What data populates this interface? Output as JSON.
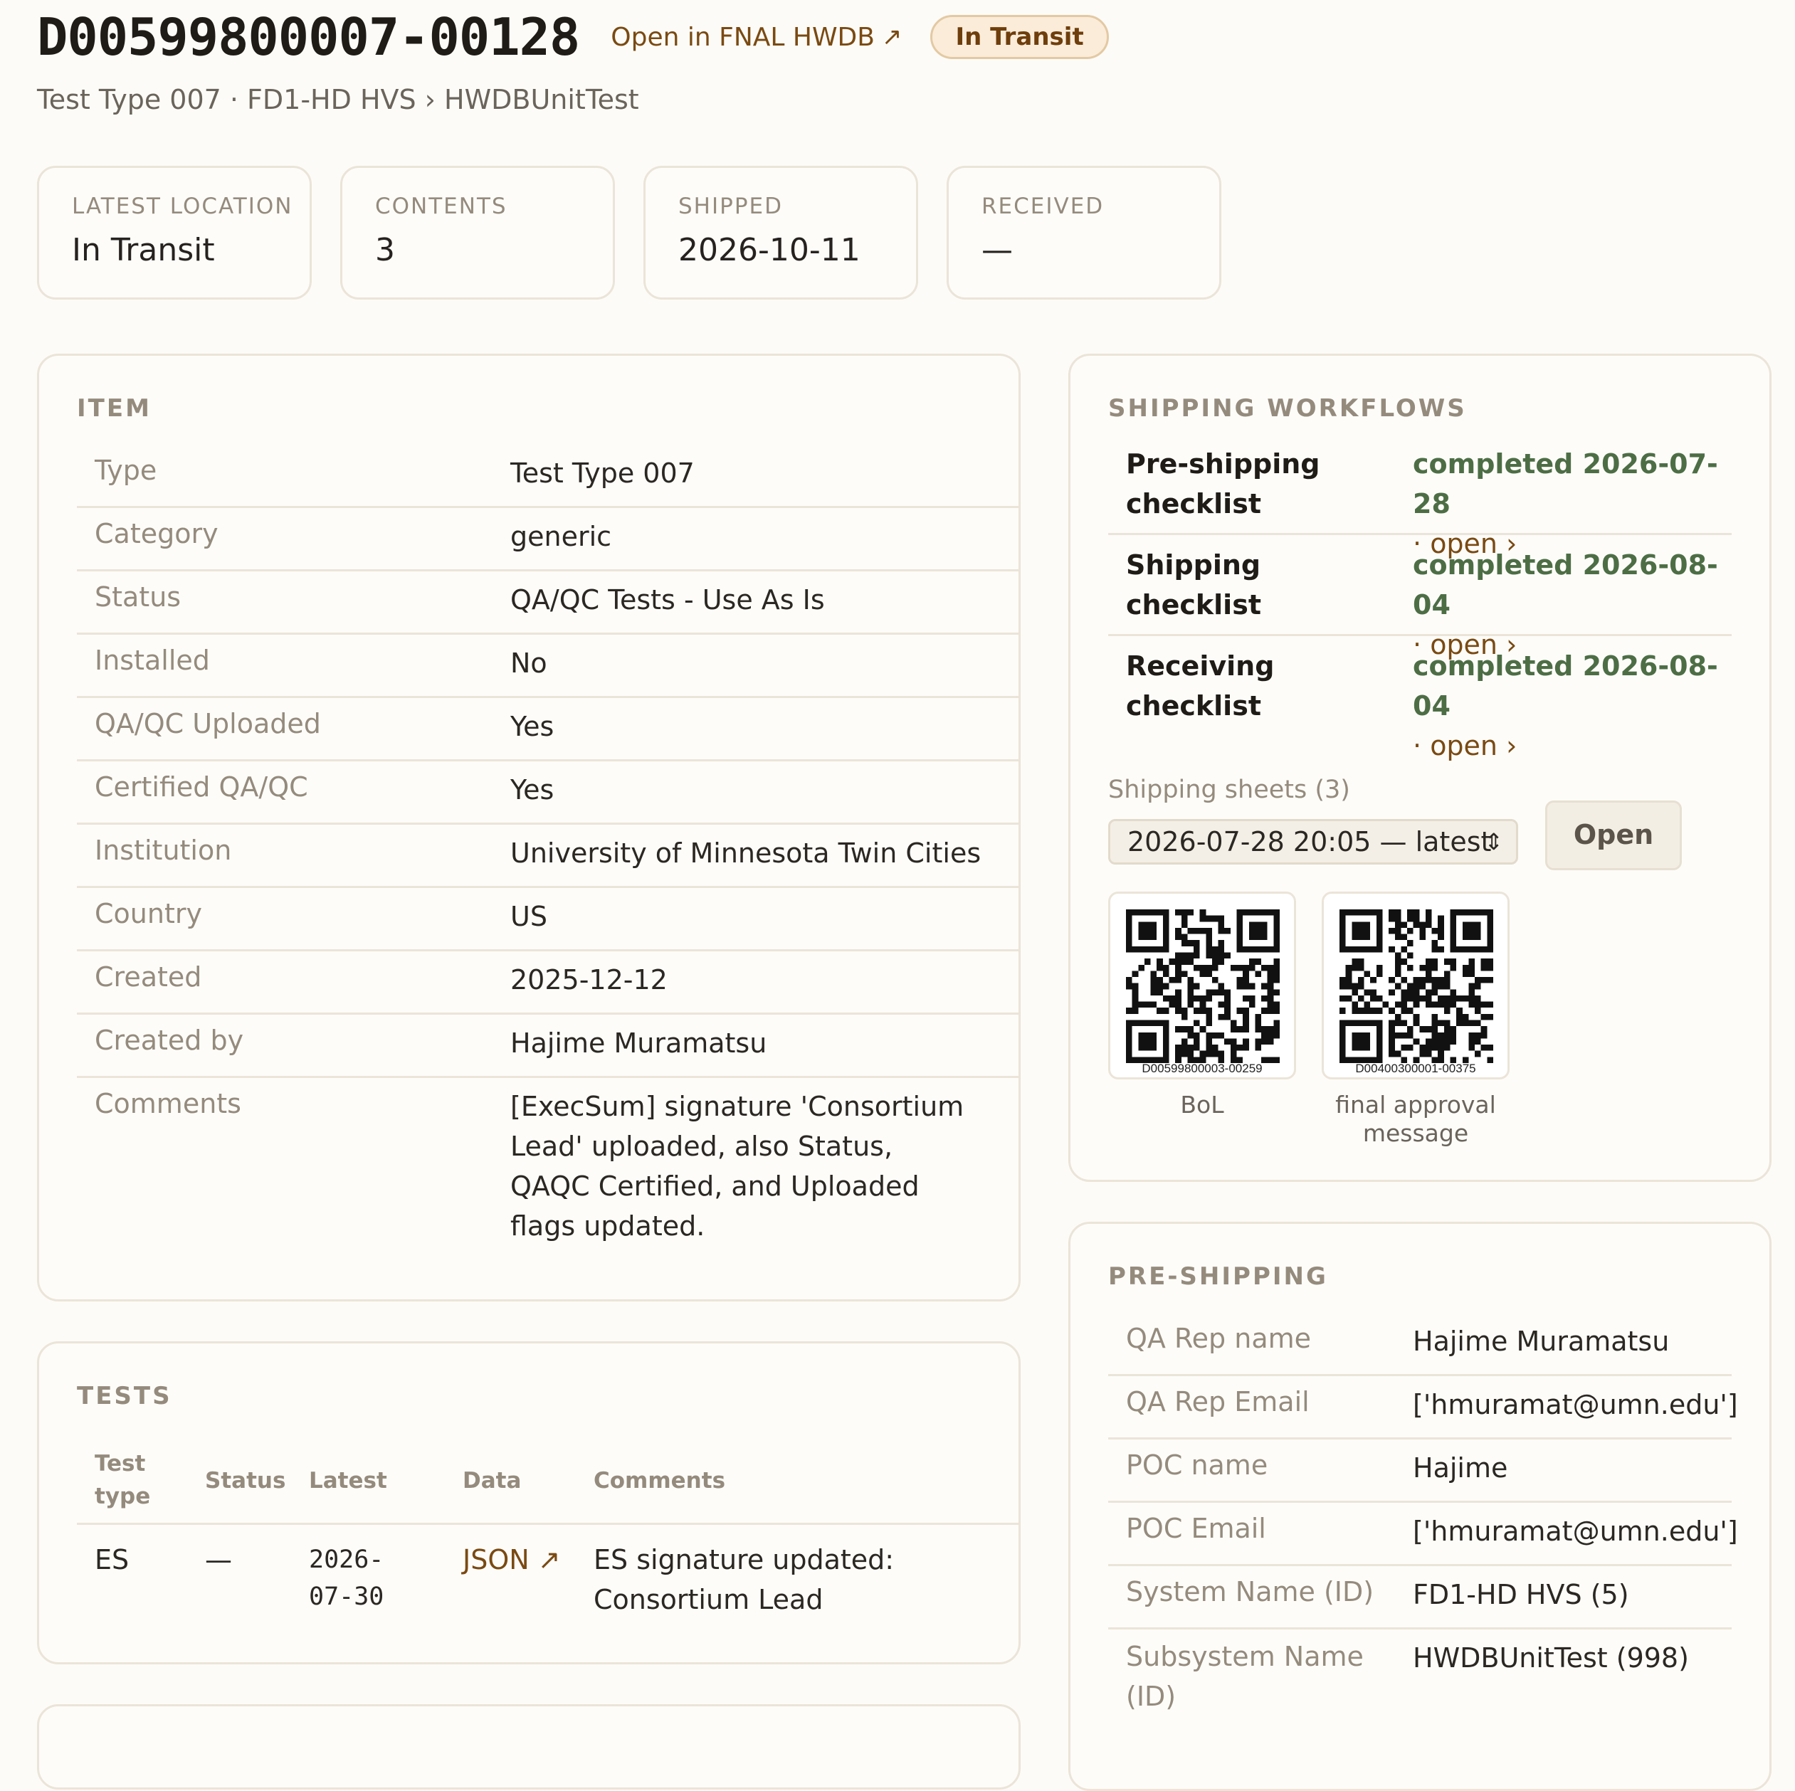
{
  "header": {
    "item_id": "D00599800007-00128",
    "external_link": "Open in FNAL HWDB",
    "external_link_icon": "arrow-up-right-icon",
    "status_badge": "In Transit",
    "subtitle": "Test Type 007 · FD1-HD HVS › HWDBUnitTest"
  },
  "stats": [
    {
      "label": "LATEST LOCATION",
      "value": "In Transit"
    },
    {
      "label": "CONTENTS",
      "value": "3"
    },
    {
      "label": "SHIPPED",
      "value": "2026-10-11"
    },
    {
      "label": "RECEIVED",
      "value": "—"
    }
  ],
  "item": {
    "title": "ITEM",
    "rows": [
      {
        "key": "Type",
        "value": "Test Type 007"
      },
      {
        "key": "Category",
        "value": "generic"
      },
      {
        "key": "Status",
        "value": "QA/QC Tests - Use As Is"
      },
      {
        "key": "Installed",
        "value": "No"
      },
      {
        "key": "QA/QC Uploaded",
        "value": "Yes"
      },
      {
        "key": "Certified QA/QC",
        "value": "Yes"
      },
      {
        "key": "Institution",
        "value": "University of Minnesota Twin Cities"
      },
      {
        "key": "Country",
        "value": "US"
      },
      {
        "key": "Created",
        "value": "2025-12-12"
      },
      {
        "key": "Created by",
        "value": "Hajime Muramatsu"
      },
      {
        "key": "Comments",
        "value": "[ExecSum] signature 'Consortium Lead' uploaded, also Status, QAQC Certified, and Uploaded flags updated."
      }
    ]
  },
  "tests": {
    "title": "TESTS",
    "columns": [
      "Test type",
      "Status",
      "Latest",
      "Data",
      "Comments"
    ],
    "rows": [
      {
        "test_type": "ES",
        "status": "—",
        "latest": "2026-07-30",
        "data": "JSON ↗",
        "comments": "ES signature updated: Consortium Lead"
      }
    ]
  },
  "shipping_workflows": {
    "title": "SHIPPING WORKFLOWS",
    "workflows": [
      {
        "name": "Pre-shipping checklist",
        "status": "completed 2026-07-28",
        "separator": "·",
        "action": "open ›"
      },
      {
        "name": "Shipping checklist",
        "status": "completed 2026-08-04",
        "separator": "·",
        "action": "open ›"
      },
      {
        "name": "Receiving checklist",
        "status": "completed 2026-08-04",
        "separator": "·",
        "action": "open ›"
      }
    ],
    "sheets_label": "Shipping sheets (3)",
    "sheets_selected": "2026-07-28 20:05 — latest",
    "open_button": "Open",
    "qr_codes": [
      {
        "id": "D00599800003-00259",
        "caption": "BoL"
      },
      {
        "id": "D00400300001-00375",
        "caption": "final approval message"
      }
    ]
  },
  "pre_shipping": {
    "title": "PRE-SHIPPING",
    "rows": [
      {
        "key": "QA Rep name",
        "value": "Hajime Muramatsu"
      },
      {
        "key": "QA Rep Email",
        "value": "['hmuramat@umn.edu']"
      },
      {
        "key": "POC name",
        "value": "Hajime"
      },
      {
        "key": "POC Email",
        "value": "['hmuramat@umn.edu']"
      },
      {
        "key": "System Name (ID)",
        "value": "FD1-HD HVS (5)"
      },
      {
        "key": "Subsystem Name (ID)",
        "value": "HWDBUnitTest (998)"
      }
    ]
  },
  "colors": {
    "accent_link": "#7a4a12",
    "completed_green": "#4d6e45",
    "badge_bg": "#fbecd9",
    "label_gray": "#958b7d",
    "background": "#fcfbf7"
  }
}
